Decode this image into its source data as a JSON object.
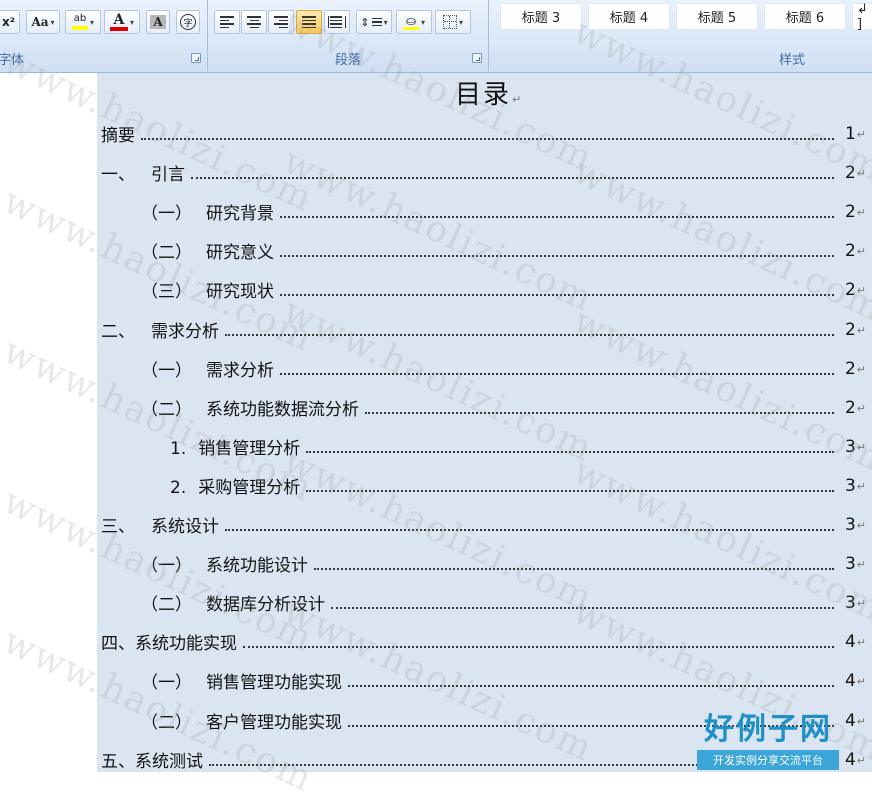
{
  "ribbon": {
    "groups": {
      "font": "字体",
      "paragraph": "段落",
      "styles": "样式"
    },
    "font_buttons": {
      "superscript": "x²",
      "change_case": "Aa",
      "highlight_letters": "ab",
      "font_color_letter": "A",
      "char_shading_letter": "A",
      "enclose_char": "字"
    },
    "style_gallery": [
      "标题 3",
      "标题 4",
      "标题 5",
      "标题 6"
    ],
    "style_more": "↲ ]"
  },
  "document": {
    "title": "目录",
    "paragraph_mark": "↵",
    "toc": [
      {
        "num": "",
        "text": "摘要",
        "page": "1"
      },
      {
        "num": "一、",
        "text": "引言",
        "page": "2"
      },
      {
        "num": "（一）",
        "text": "研究背景",
        "page": "2"
      },
      {
        "num": "（二）",
        "text": "研究意义",
        "page": "2"
      },
      {
        "num": "（三）",
        "text": "研究现状",
        "page": "2"
      },
      {
        "num": "二、",
        "text": "需求分析",
        "page": "2"
      },
      {
        "num": "（一）",
        "text": "需求分析",
        "page": "2"
      },
      {
        "num": "（二）",
        "text": "系统功能数据流分析",
        "page": "2"
      },
      {
        "num": "1.",
        "text": "销售管理分析",
        "page": "3"
      },
      {
        "num": "2.",
        "text": "采购管理分析",
        "page": "3"
      },
      {
        "num": "三、",
        "text": "系统设计",
        "page": "3"
      },
      {
        "num": "（一）",
        "text": "系统功能设计",
        "page": "3"
      },
      {
        "num": "（二）",
        "text": "数据库分析设计",
        "page": "3"
      },
      {
        "num": "四、",
        "text": "系统功能实现",
        "page": "4"
      },
      {
        "num": "（一）",
        "text": "销售管理功能实现",
        "page": "4"
      },
      {
        "num": "（二）",
        "text": "客户管理功能实现",
        "page": "4"
      },
      {
        "num": "五、",
        "text": "系统测试",
        "page": "4"
      }
    ]
  },
  "watermark": {
    "text": "www.haolizi.com",
    "logo_main": "好例子网",
    "logo_sub": "开发实例分享交流平台"
  },
  "colors": {
    "page_bg": "#dbe5f1",
    "ribbon_label": "#3e6aa7",
    "highlight": "#ffff00",
    "font_color": "#e00000"
  }
}
